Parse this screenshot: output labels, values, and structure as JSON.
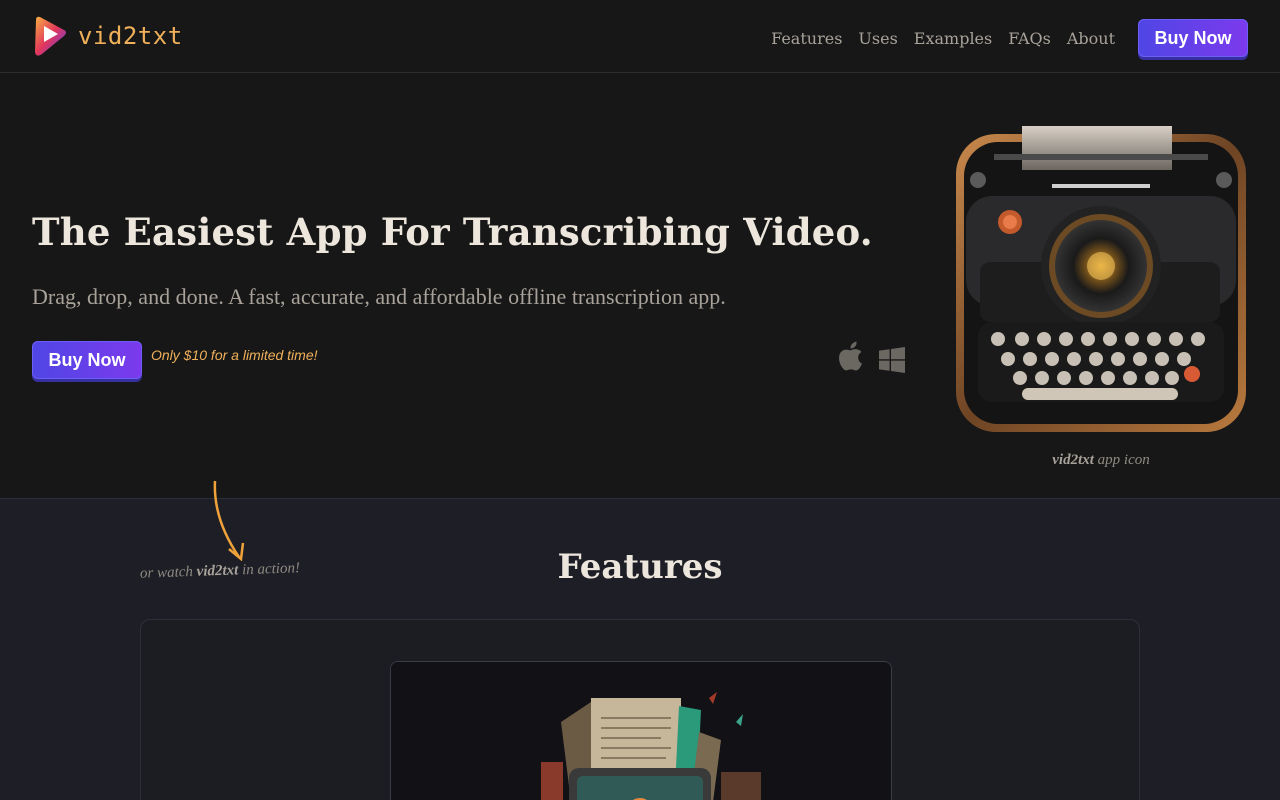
{
  "header": {
    "brand": "vid2txt",
    "nav": [
      "Features",
      "Uses",
      "Examples",
      "FAQs",
      "About"
    ],
    "buy_label": "Buy Now"
  },
  "hero": {
    "title": "The Easiest App For Transcribing Video.",
    "subtitle": "Drag, drop, and done. A fast, accurate, and affordable offline transcription app.",
    "buy_label": "Buy Now",
    "promo": "Only $10 for a limited time!",
    "platform_icons": [
      "apple-icon",
      "windows-icon"
    ],
    "icon_caption_brand": "vid2txt",
    "icon_caption_rest": " app icon"
  },
  "features": {
    "watch_prefix": "or watch ",
    "watch_brand": "vid2txt",
    "watch_suffix": " in action!",
    "title": "Features"
  },
  "colors": {
    "accent": "#f0b05a",
    "button": "#5b4cf0",
    "background": "#171717",
    "features_bg": "#1e1f26"
  }
}
